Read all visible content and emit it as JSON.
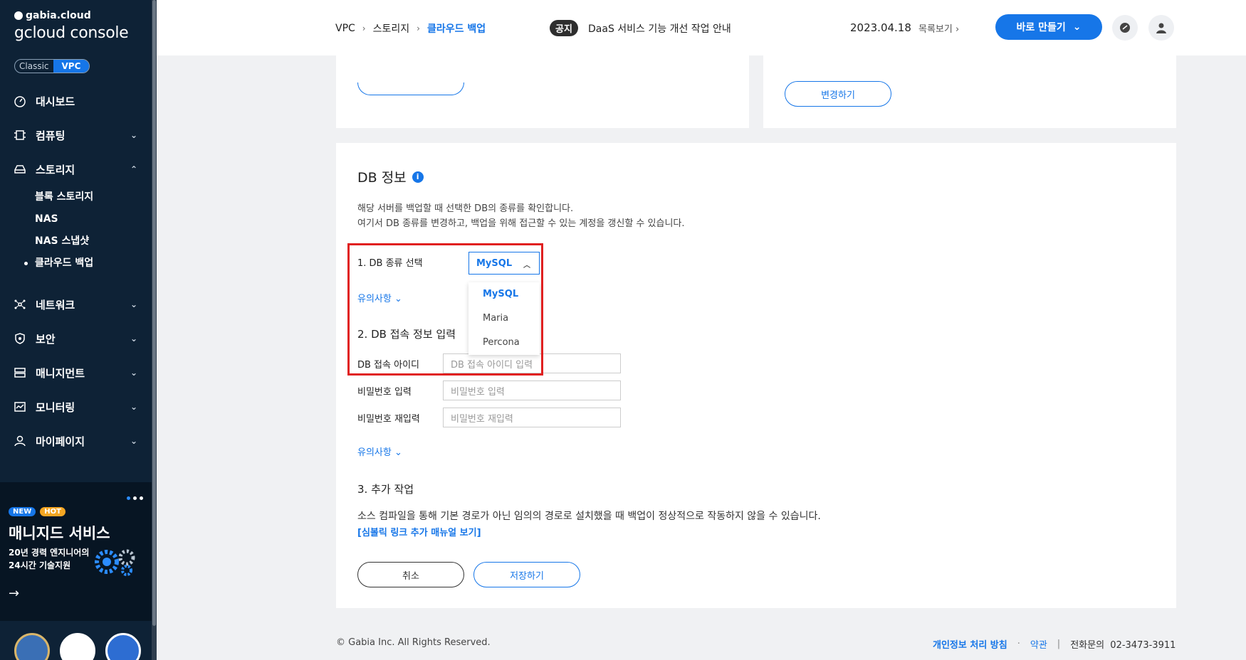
{
  "sidebar": {
    "brand_small": "gabia.cloud",
    "brand_big": "gcloud console",
    "toggle": {
      "classic": "Classic",
      "vpc": "VPC"
    },
    "menu": {
      "dashboard": "대시보드",
      "computing": "컴퓨팅",
      "storage": "스토리지",
      "network": "네트워크",
      "security": "보안",
      "management": "매니지먼트",
      "monitoring": "모니터링",
      "mypage": "마이페이지"
    },
    "storage_sub": [
      "블록 스토리지",
      "NAS",
      "NAS 스냅샷",
      "클라우드 백업"
    ],
    "promo": {
      "badge_new": "NEW",
      "badge_hot": "HOT",
      "title": "매니지드 서비스",
      "desc": "20년 경력 엔지니어의 24시간 기술지원",
      "arrow": "→"
    }
  },
  "header": {
    "breadcrumb": [
      "VPC",
      "스토리지",
      "클라우드 백업"
    ],
    "notice_tag": "공지",
    "notice_text": "DaaS 서비스 기능 개선 작업 안내",
    "notice_date": "2023.04.18",
    "notice_more": "목록보기",
    "make_button": "바로 만들기"
  },
  "top_right_card": {
    "change_button": "변경하기"
  },
  "db_info": {
    "title": "DB 정보",
    "desc_line1": "해당 서버를 백업할 때 선택한 DB의 종류를 확인합니다.",
    "desc_line2": "여기서 DB 종류를 변경하고, 백업을 위해 접근할 수 있는 계정을 갱신할 수 있습니다.",
    "step1": "1. DB 종류 선택",
    "selected_db": "MySQL",
    "db_options": [
      "MySQL",
      "Maria",
      "Percona"
    ],
    "notes_link": "유의사항",
    "step2": "2. DB 접속 정보 입력",
    "fields": {
      "id_label": "DB 접속 아이디",
      "id_placeholder": "DB 접속 아이디 입력",
      "pw_label": "비밀번호 입력",
      "pw_placeholder": "비밀번호 입력",
      "pw2_label": "비밀번호 재입력",
      "pw2_placeholder": "비밀번호 재입력"
    },
    "step3": "3. 추가 작업",
    "extra_desc": "소스 컴파일을 통해 기본 경로가 아닌 임의의 경로로 설치했을 때 백업이 정상적으로 작동하지 않을 수 있습니다.",
    "extra_link": "[심볼릭 링크 추가 매뉴얼 보기]",
    "cancel_button": "취소",
    "save_button": "저장하기"
  },
  "footer": {
    "copyright": "© Gabia Inc. All Rights Reserved.",
    "policy": "개인정보 처리 방침",
    "terms": "약관",
    "phone_label": "전화문의",
    "phone": "02-3473-3911"
  },
  "colors": {
    "accent": "#1676e8",
    "sidebar_bg": "#0e2236",
    "highlight": "#e02020"
  }
}
